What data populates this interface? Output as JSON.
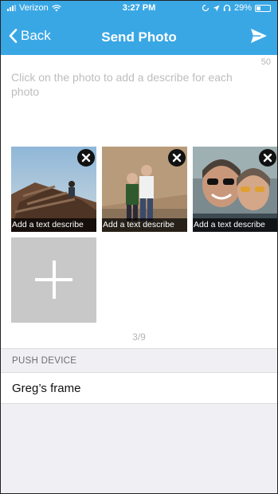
{
  "status_bar": {
    "carrier": "Verizon",
    "time": "3:27 PM",
    "battery": "29%",
    "battery_level": 0.29
  },
  "nav": {
    "back_label": "Back",
    "title": "Send Photo"
  },
  "describe": {
    "char_count": "50",
    "hint": "Click on the photo to add a describe for each photo"
  },
  "photos": [
    {
      "caption": "Add a text describe"
    },
    {
      "caption": "Add a text describe"
    },
    {
      "caption": "Add a text describe"
    }
  ],
  "photo_count": "3/9",
  "push_device": {
    "header": "PUSH DEVICE",
    "device_name": "Greg’s frame"
  },
  "colors": {
    "nav_blue": "#3aa7e5",
    "section_gray": "#efeff4"
  },
  "icons": [
    "back-chevron-icon",
    "send-paper-plane-icon",
    "remove-x-icon",
    "plus-icon",
    "wifi-icon",
    "battery-icon",
    "location-icon",
    "headphones-icon"
  ]
}
